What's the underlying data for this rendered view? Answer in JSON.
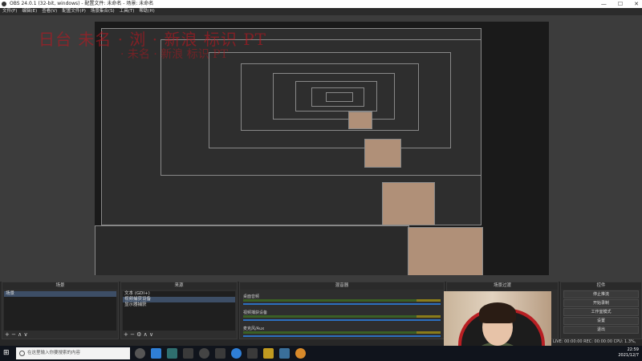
{
  "window": {
    "title": "OBS 24.0.1 (32-bit, windows) - 配置文件: 未命名 - 场景: 未命名",
    "min_icon": "minimize-icon",
    "max_icon": "maximize-icon",
    "close_icon": "close-icon"
  },
  "menu": [
    "文件(F)",
    "编辑(E)",
    "查看(V)",
    "配置文件(P)",
    "场景集合(S)",
    "工具(T)",
    "帮助(H)"
  ],
  "overlay": {
    "line1": "日台 未名 · 浏 · 新浪 标识 PT",
    "line2": "· 未名 · 新浪 标识 PT"
  },
  "docks": {
    "scenes": {
      "title": "场景",
      "items": [
        "场景"
      ],
      "footer": "+ − ∧ ∨"
    },
    "sources": {
      "title": "来源",
      "items": [
        "文本 (GDI+)",
        "视频捕获设备",
        "显示器捕获"
      ],
      "footer": "+ − ⚙ ∧ ∨"
    },
    "mixer": {
      "title": "混音器",
      "rows": [
        {
          "name": "桌面音频",
          "db": "0.0 dB"
        },
        {
          "name": "视频捕获设备",
          "db": "0.0 dB"
        },
        {
          "name": "麦克风/Aux",
          "db": "0.0 dB"
        }
      ]
    },
    "transitions": {
      "title": "场景过渡"
    },
    "controls": {
      "title": "控件",
      "buttons": [
        "停止推流",
        "开始录制",
        "工作室模式",
        "设置",
        "退出"
      ]
    }
  },
  "status": {
    "text": "LIVE: 00:00:00  REC: 00:00:00  CPU: 1.3%, 60.00 fps"
  },
  "taskbar": {
    "search_placeholder": "在这里输入你要搜索的内容",
    "start_icon": "windows-start-icon",
    "time": "22:59",
    "date": "2021/12/7",
    "icons": [
      "task-view-icon",
      "edge-icon",
      "xbox-icon",
      "wechat-icon",
      "obs-icon",
      "app-icon",
      "browser-icon",
      "explorer-icon",
      "game-icon",
      "mountain-icon",
      "bird-icon"
    ]
  },
  "colors": {
    "accent": "#2c6fbf",
    "meter_green": "#3b5f25",
    "meter_yellow": "#8a7c1a",
    "overlay_red": "#c8141e",
    "chair_red": "#b81f23"
  }
}
